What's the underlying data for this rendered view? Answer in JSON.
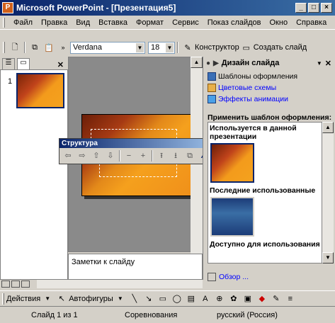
{
  "window": {
    "title": "Microsoft PowerPoint - [Презентация5]"
  },
  "menu": {
    "items": [
      "Файл",
      "Правка",
      "Вид",
      "Вставка",
      "Формат",
      "Сервис",
      "Показ слайдов",
      "Окно",
      "Справка"
    ]
  },
  "format_toolbar": {
    "font": "Verdana",
    "size": "18",
    "designer": "Конструктор",
    "new_slide": "Создать слайд"
  },
  "slides_pane": {
    "slide_number": "1"
  },
  "structure_toolbar": {
    "title": "Структура"
  },
  "notes": {
    "placeholder": "Заметки к слайду"
  },
  "task_pane": {
    "title": "Дизайн слайда",
    "links": [
      "Шаблоны оформления",
      "Цветовые схемы",
      "Эффекты анимации"
    ],
    "apply_label": "Применить шаблон оформления:",
    "groups": [
      "Используется в данной презентации",
      "Последние использованные",
      "Доступно для использования"
    ],
    "browse": "Обзор ..."
  },
  "drawing_toolbar": {
    "actions": "Действия",
    "autoshapes": "Автофигуры"
  },
  "status_bar": {
    "slide": "Слайд 1 из 1",
    "design": "Соревнования",
    "language": "русский (Россия)"
  },
  "colors": {
    "title_bar": "#0a246a",
    "accent_orange": "#f5a01d",
    "accent_dark_red": "#6b1e08"
  }
}
